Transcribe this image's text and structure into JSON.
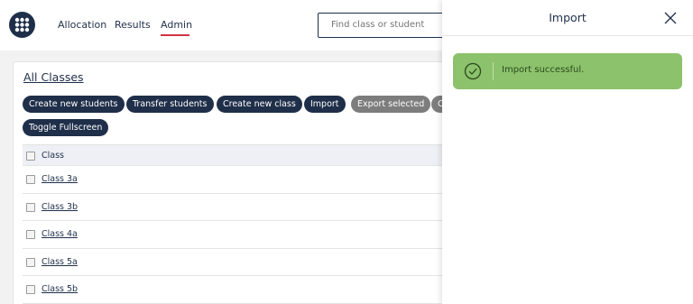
{
  "nav": {
    "items": [
      {
        "label": "Allocation"
      },
      {
        "label": "Results"
      },
      {
        "label": "Admin"
      }
    ],
    "active": "Admin",
    "accent": "#d23241"
  },
  "search": {
    "placeholder": "Find class or student"
  },
  "classes": {
    "title": "All Classes",
    "buttons": {
      "create_students": "Create new students",
      "transfer_students": "Transfer students",
      "create_class": "Create new class",
      "import": "Import",
      "export_selected": "Export selected",
      "truncated": "C",
      "toggle_fullscreen": "Toggle Fullscreen"
    },
    "table": {
      "header": "Class",
      "rows": [
        "Class 3a",
        "Class 3b",
        "Class 4a",
        "Class 5a",
        "Class 5b"
      ]
    }
  },
  "panel": {
    "title": "Import",
    "toast": {
      "message": "Import successful.",
      "color": "#8cc26b"
    }
  },
  "colors": {
    "primary": "#1f2f4a",
    "disabled": "#7d7d7d"
  }
}
